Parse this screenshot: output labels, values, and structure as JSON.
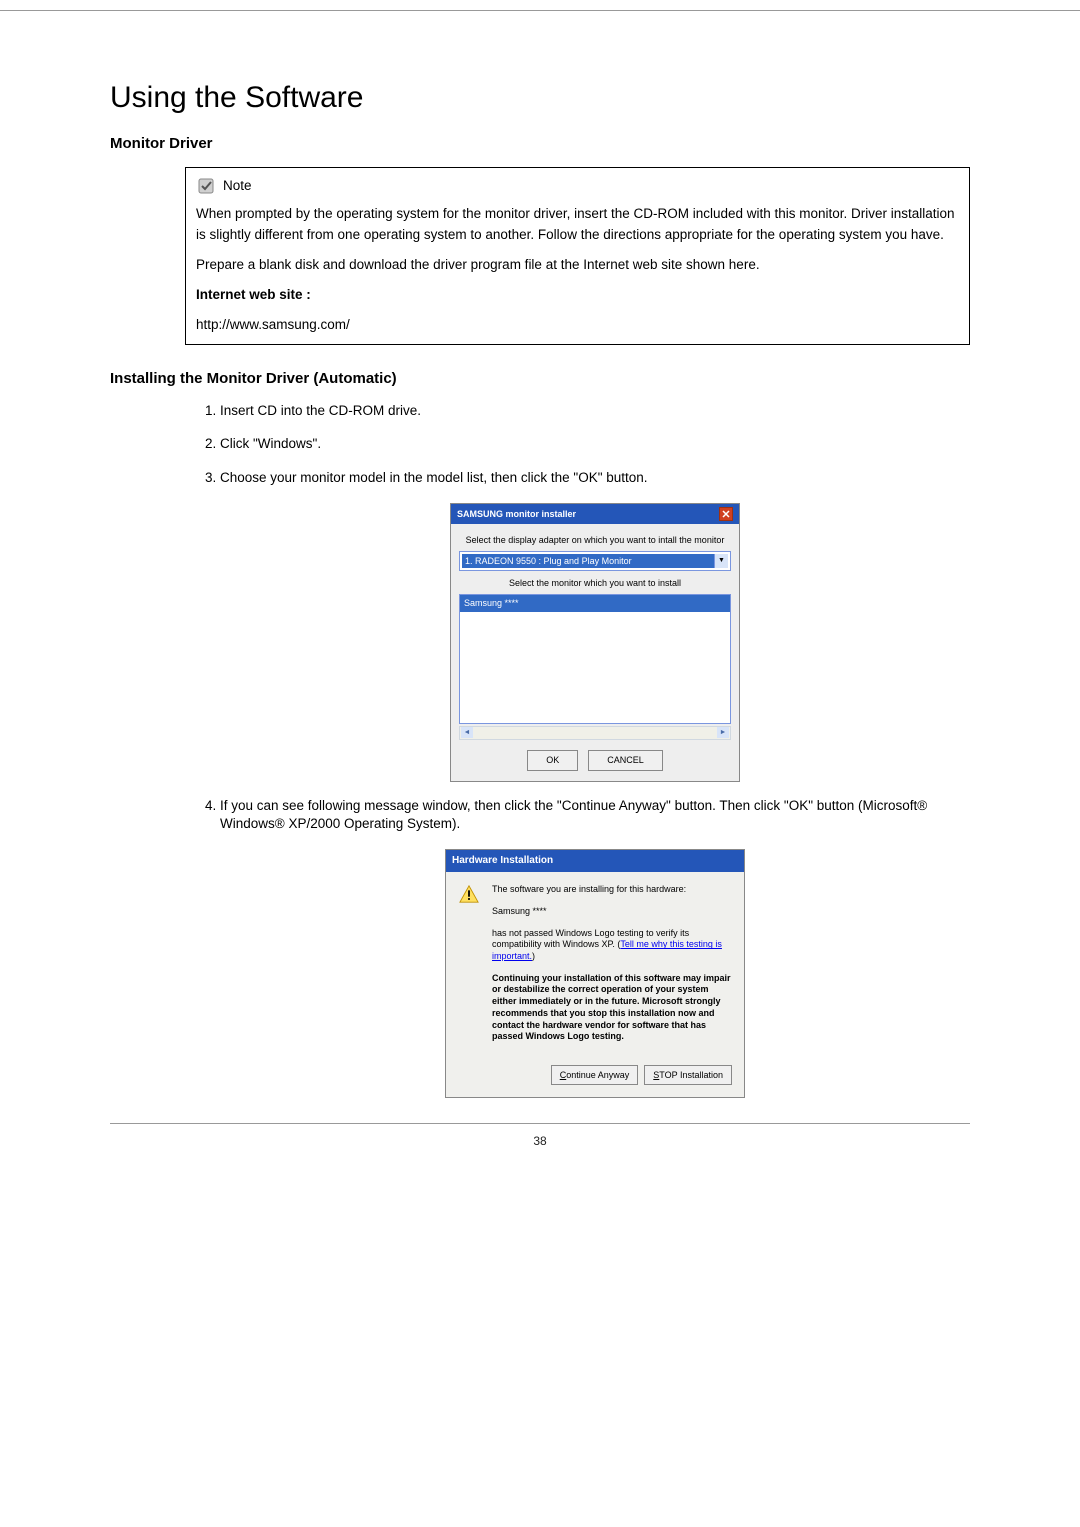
{
  "page": {
    "title": "Using the Software",
    "number": "38"
  },
  "section1": {
    "heading": "Monitor Driver"
  },
  "note": {
    "label": "Note",
    "para1": "When prompted by the operating system for the monitor driver, insert the CD-ROM included with this monitor. Driver installation is slightly different from one operating system to another. Follow the directions appropriate for the operating system you have.",
    "para2": "Prepare a blank disk and download the driver program file at the Internet web site shown here.",
    "websiteLabel": "Internet web site :",
    "url": "http://www.samsung.com/"
  },
  "section2": {
    "heading": "Installing the Monitor Driver (Automatic)",
    "steps": [
      "Insert CD into the CD-ROM drive.",
      "Click \"Windows\".",
      "Choose your monitor model in the model list, then click the \"OK\" button.",
      "If you can see following message window, then click the \"Continue Anyway\" button. Then click \"OK\" button (Microsoft® Windows® XP/2000 Operating System)."
    ]
  },
  "installer": {
    "title": "SAMSUNG monitor installer",
    "label1": "Select the display adapter on which you want to intall the monitor",
    "dropdown_selected": "1. RADEON 9550 : Plug and Play Monitor",
    "label2": "Select the monitor which you want to install",
    "list_item": "Samsung ****",
    "ok": "OK",
    "cancel": "CANCEL"
  },
  "hardware": {
    "title": "Hardware Installation",
    "intro": "The software you are installing for this hardware:",
    "device": "Samsung ****",
    "warning1a": "has not passed Windows Logo testing to verify its compatibility with Windows XP. (",
    "link": "Tell me why this testing is important.",
    "warning1b": ")",
    "warning2": "Continuing your installation of this software may impair or destabilize the correct operation of your system either immediately or in the future. Microsoft strongly recommends that you stop this installation now and contact the hardware vendor for software that has passed Windows Logo testing.",
    "continue_btn": "Continue Anyway",
    "stop_btn": "STOP Installation"
  }
}
